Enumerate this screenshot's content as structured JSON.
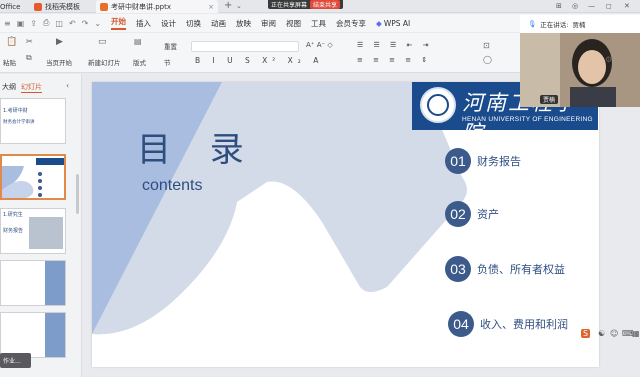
{
  "titlebar": {
    "tab_office": "Office",
    "tab_template": "找稻壳模板",
    "tab_file": "考研中财串讲.pptx",
    "share_text": "正在共享屏幕",
    "share_stop": "结束共享"
  },
  "menu": {
    "items": [
      "开始",
      "插入",
      "设计",
      "切换",
      "动画",
      "放映",
      "审阅",
      "视图",
      "工具",
      "会员专享"
    ],
    "active": "开始",
    "wps_ai": "WPS AI"
  },
  "ribbon": {
    "paste": "粘贴",
    "from_start": "当页开始",
    "new_slide": "新建幻灯片",
    "layout": "版式",
    "section": "节",
    "reset": "重置"
  },
  "leftpanel": {
    "tab_outline": "大纲",
    "tab_slides": "幻灯片",
    "thumb1_title": "1.考研中财",
    "thumb1_sub": "财务会计学串讲",
    "thumb3_label": "1.研究生",
    "thumb3_sub": "财务报告",
    "toast_text": "作业..."
  },
  "video": {
    "speaking_label": "正在讲话:",
    "speaker": "贾楠",
    "name_tag": "贾楠"
  },
  "slide": {
    "title": "目 录",
    "subtitle": "contents",
    "logo_cn": "河南工程学院",
    "logo_en": "HENAN UNIVERSITY OF ENGINEERING",
    "toc": [
      {
        "num": "01",
        "label": "财务报告"
      },
      {
        "num": "02",
        "label": "资产"
      },
      {
        "num": "03",
        "label": "负债、所有者权益"
      },
      {
        "num": "04",
        "label": "收入、费用和利润"
      }
    ]
  },
  "colors": {
    "accent": "#d5582e",
    "slide_blue": "#2f4e80",
    "shape_blue": "#a9bde0",
    "logo_bg": "#1a4b8c"
  }
}
